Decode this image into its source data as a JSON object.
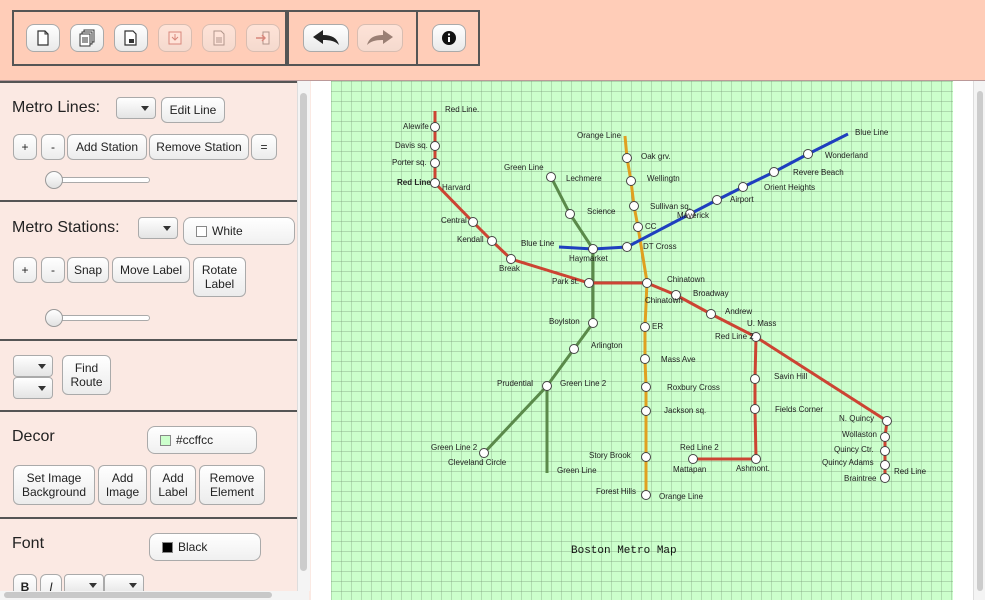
{
  "left_panel": {
    "metro_lines": {
      "title": "Metro Lines:",
      "edit_line": "Edit Line",
      "plus": "+",
      "minus": "-",
      "add_station": "Add Station",
      "remove_station": "Remove Station",
      "equals": "="
    },
    "metro_stations": {
      "title": "Metro Stations:",
      "color_label": "White",
      "color_hex": "#ffffff",
      "plus": "+",
      "minus": "-",
      "snap": "Snap",
      "move_label": "Move Label",
      "rotate_label": "Rotate Label"
    },
    "route": {
      "find_route": "Find Route"
    },
    "decor": {
      "title": "Decor",
      "color_label": "#ccffcc",
      "color_hex": "#ccffcc",
      "set_image_background": "Set Image Background",
      "add_image": "Add Image",
      "add_label": "Add Label",
      "remove_element": "Remove Element"
    },
    "font": {
      "title": "Font",
      "color_label": "Black",
      "color_hex": "#000000",
      "bold": "B",
      "italic": "I"
    }
  },
  "map": {
    "background": "#ccffcc",
    "title": "Boston Metro Map",
    "colors": {
      "red": "#cc4433",
      "blue": "#1f3fbf",
      "green": "#5a8a4a",
      "orange": "#e0a020"
    },
    "line_labels": [
      "Red Line.",
      "Orange Line",
      "Blue Line",
      "Green Line",
      "Red Line",
      "Blue Line",
      "Green Line 2",
      "Red Line 2",
      "Green Line 2",
      "Green Line",
      "Red Line 2",
      "Orange Line",
      "Red Line"
    ],
    "stations": [
      "Alewife",
      "Davis sq.",
      "Porter sq.",
      "Harvard",
      "Central",
      "Kendall",
      "Break",
      "Park st.",
      "Chinatown",
      "Chinatown",
      "Broadway",
      "Andrew",
      "U. Mass",
      "Savin Hill",
      "Fields Corner",
      "Ashmont.",
      "Mattapan",
      "N. Quincy",
      "Wollaston",
      "Quincy Ctr.",
      "Quincy Adams",
      "Braintree",
      "Lechmere",
      "Science",
      "Haymarket",
      "Boylston",
      "Arlington",
      "Prudential",
      "Cleveland Circle",
      "Oak grv.",
      "Wellingtn",
      "Sullivan sq.",
      "CC",
      "DT Cross",
      "ER",
      "Mass Ave",
      "Roxbury Cross",
      "Jackson sq.",
      "Story Brook",
      "Forest Hills",
      "Maverick",
      "Airport",
      "Orient Heights",
      "Revere Beach",
      "Wonderland"
    ]
  }
}
